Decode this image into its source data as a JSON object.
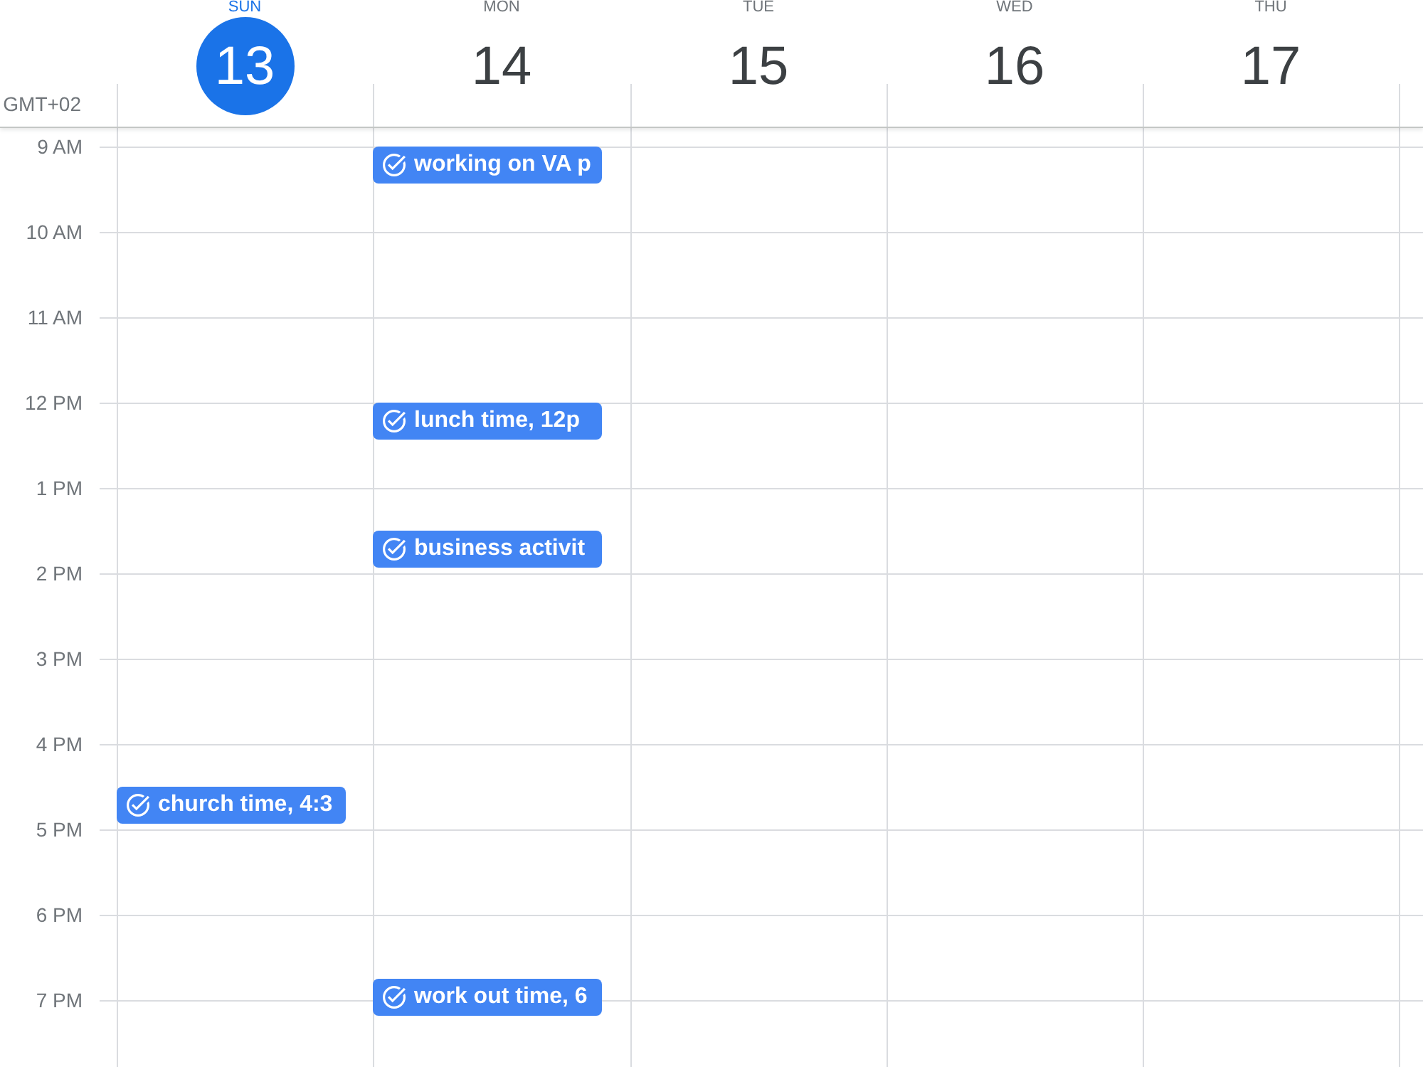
{
  "timezone": "GMT+02",
  "hours": [
    "9 AM",
    "10 AM",
    "11 AM",
    "12 PM",
    "1 PM",
    "2 PM",
    "3 PM",
    "4 PM",
    "5 PM",
    "6 PM",
    "7 PM"
  ],
  "days": [
    {
      "weekday": "SUN",
      "date": "13",
      "selected": true,
      "events": [
        {
          "title": "church time, 4:3"
        }
      ]
    },
    {
      "weekday": "MON",
      "date": "14",
      "selected": false,
      "events": [
        {
          "title": "working on VA p"
        },
        {
          "title": "lunch time, 12p"
        },
        {
          "title": "business activit"
        },
        {
          "title": "work out time, 6"
        }
      ]
    },
    {
      "weekday": "TUE",
      "date": "15",
      "selected": false
    },
    {
      "weekday": "WED",
      "date": "16",
      "selected": false
    },
    {
      "weekday": "THU",
      "date": "17",
      "selected": false
    }
  ]
}
